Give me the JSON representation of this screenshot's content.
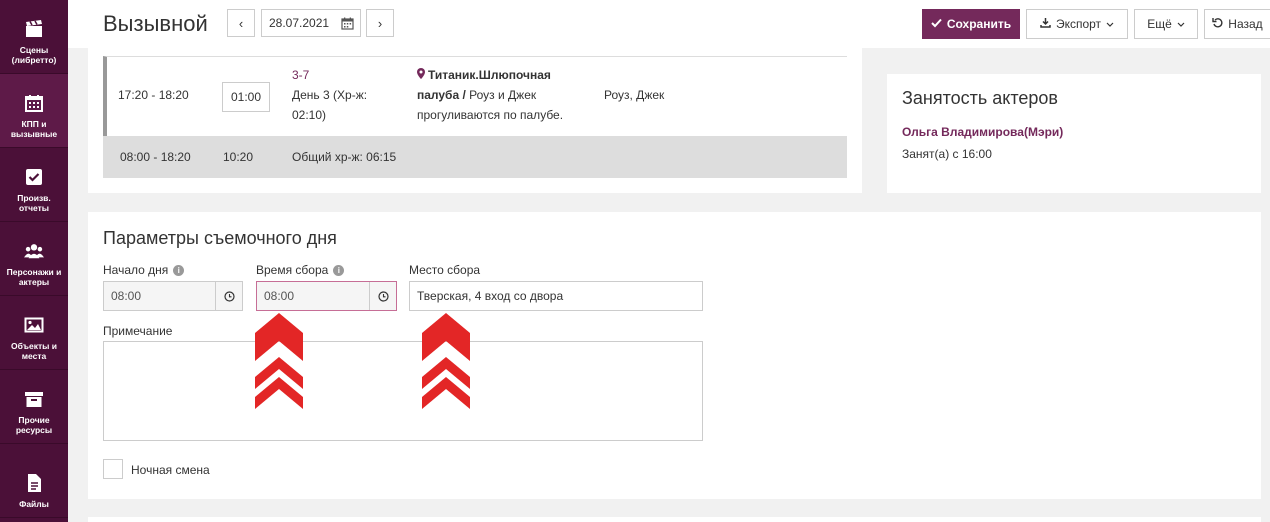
{
  "sidebar": {
    "items": [
      {
        "label": "Сцены\n(либретто)",
        "icon": "clapperboard-icon"
      },
      {
        "label": "КПП и\nвызывные",
        "icon": "calendar-icon"
      },
      {
        "label": "Произв.\nотчеты",
        "icon": "checkbox-icon"
      },
      {
        "label": "Персонажи и\nактеры",
        "icon": "people-icon"
      },
      {
        "label": "Объекты и\nместа",
        "icon": "image-icon"
      },
      {
        "label": "Прочие\nресурсы",
        "icon": "archive-icon"
      },
      {
        "label": "Файлы",
        "icon": "file-icon"
      }
    ]
  },
  "header": {
    "title": "Вызывной",
    "date": "28.07.2021",
    "prev": "‹",
    "next": "›",
    "save_label": "Сохранить",
    "export_label": "Экспорт",
    "more_label": "Ещё",
    "back_label": "Назад"
  },
  "schedule": {
    "row": {
      "time": "17:20 - 18:20",
      "duration": "01:00",
      "scene_num": "3-7",
      "scene_day": "День 3 (Хр-ж:",
      "scene_dur": "02:10)",
      "location": "Титаник.Шлюпочная",
      "location2": "палуба /",
      "desc1": " Роуз и Джек",
      "desc2": "прогуливаются по палубе.",
      "characters": "Роуз, Джек"
    },
    "total": {
      "time": "08:00 - 18:20",
      "duration": "10:20",
      "summary": "Общий хр-ж: 06:15"
    }
  },
  "actors": {
    "title": "Занятость актеров",
    "name": "Ольга Владимирова(Мэри)",
    "status": "Занят(а) с 16:00"
  },
  "params": {
    "title": "Параметры съемочного дня",
    "start_label": "Начало дня",
    "start_value": "08:00",
    "gather_label": "Время сбора",
    "gather_value": "08:00",
    "place_label": "Место сбора",
    "place_value": "Тверская, 4 вход со двора",
    "note_label": "Примечание",
    "note_value": "",
    "night_label": "Ночная смена"
  },
  "colors": {
    "sidebar": "#4b1038",
    "primary": "#74295b",
    "arrow": "#e32626"
  }
}
